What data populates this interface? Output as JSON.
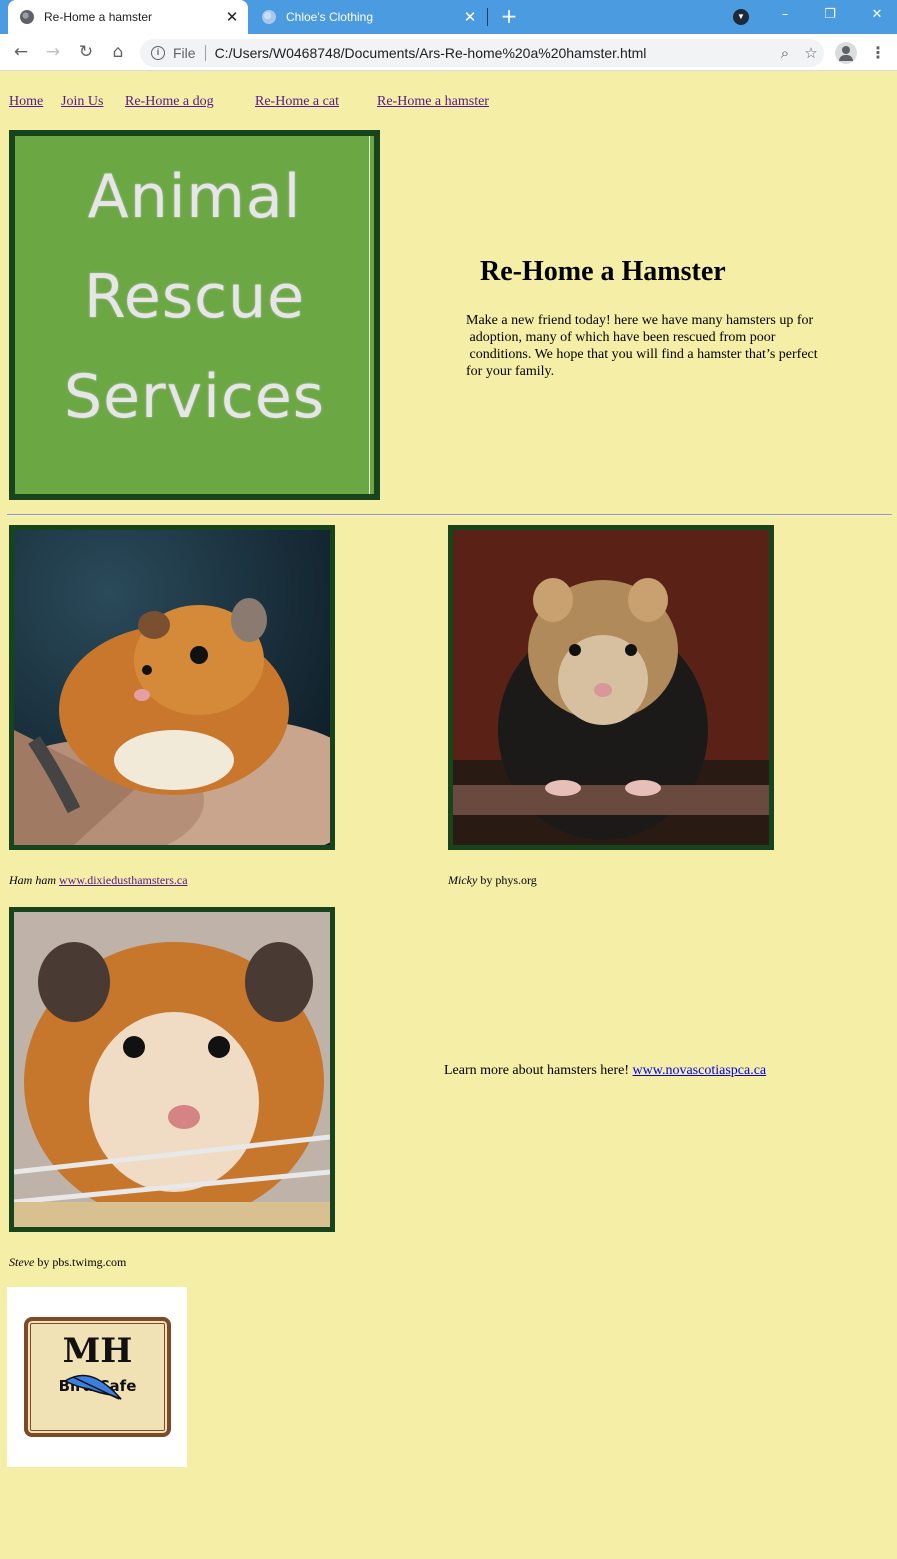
{
  "browser": {
    "tabs": [
      {
        "title": "Re-Home a hamster",
        "active": true
      },
      {
        "title": "Chloe's Clothing",
        "active": false
      }
    ],
    "address": {
      "scheme": "File",
      "url": "C:/Users/W0468748/Documents/Ars-Re-home%20a%20hamster.html"
    }
  },
  "nav": {
    "items": [
      "Home",
      "Join Us",
      "Re-Home a dog",
      "Re-Home a cat",
      "Re-Home a hamster"
    ]
  },
  "logo": {
    "lines": [
      "Animal",
      "Rescue",
      "Services"
    ],
    "color": "#6ba843"
  },
  "header": {
    "title": "Re-Home a Hamster",
    "intro_lines": [
      "Make a new friend today! here we have many hamsters up for",
      " adoption, many of which have been rescued from poor",
      " conditions. We hope that you will find a hamster that’s perfect",
      "for your family."
    ]
  },
  "hamsters": [
    {
      "name": "Ham ham",
      "sep": " ",
      "credit": "www.dixiedusthamsters.ca",
      "credit_is_link": true
    },
    {
      "name": "Micky",
      "sep": " by ",
      "credit": "phys.org",
      "credit_is_link": false
    },
    {
      "name": "Steve",
      "sep": " by ",
      "credit": "pbs.twimg.com",
      "credit_is_link": false
    }
  ],
  "learn_more": {
    "text": "Learn more about hamsters here! ",
    "link": "www.novascotiaspca.ca"
  },
  "cafe_logo": {
    "title": "MH",
    "subtitle": "Bird Cafe"
  },
  "colors": {
    "background": "#f5eea6",
    "frame": "#17441c",
    "tabbar": "#4a9be0"
  }
}
